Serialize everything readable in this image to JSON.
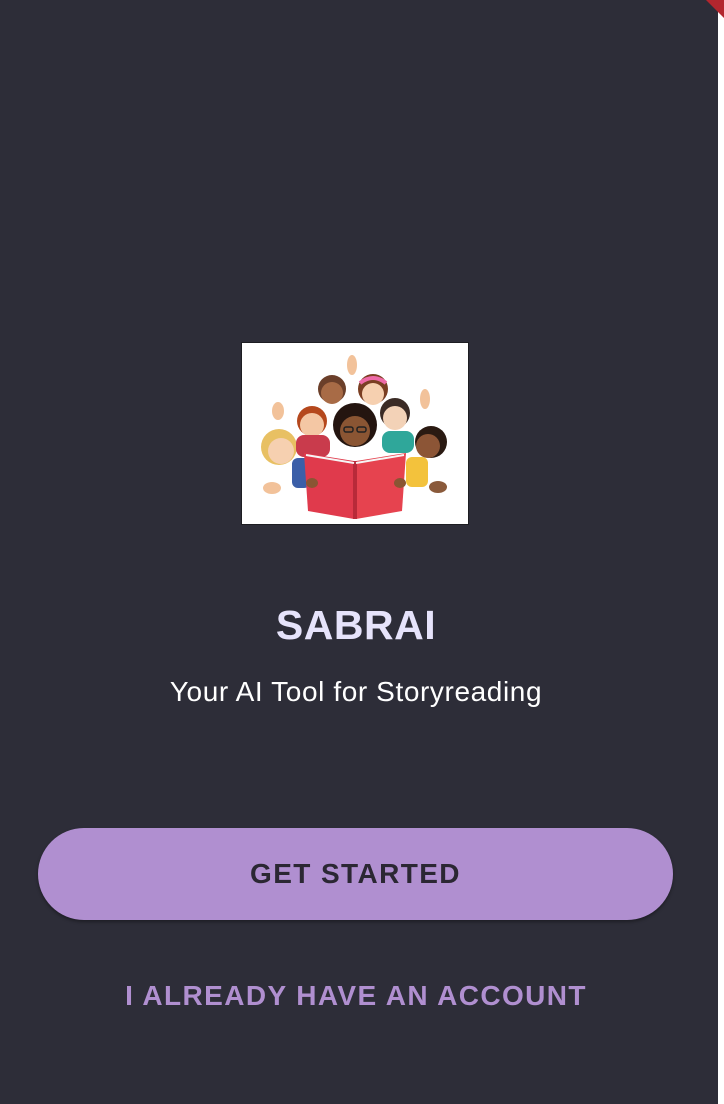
{
  "app": {
    "title": "SABRAI",
    "tagline": "Your AI Tool for Storyreading"
  },
  "logo": {
    "icon": "children-reading-book-illustration"
  },
  "actions": {
    "get_started_label": "GET STARTED",
    "have_account_label": "I ALREADY HAVE AN ACCOUNT"
  },
  "colors": {
    "background": "#2d2d38",
    "accent": "#b08fd0",
    "title": "#e6e3fb",
    "button_text": "#2b2733"
  }
}
